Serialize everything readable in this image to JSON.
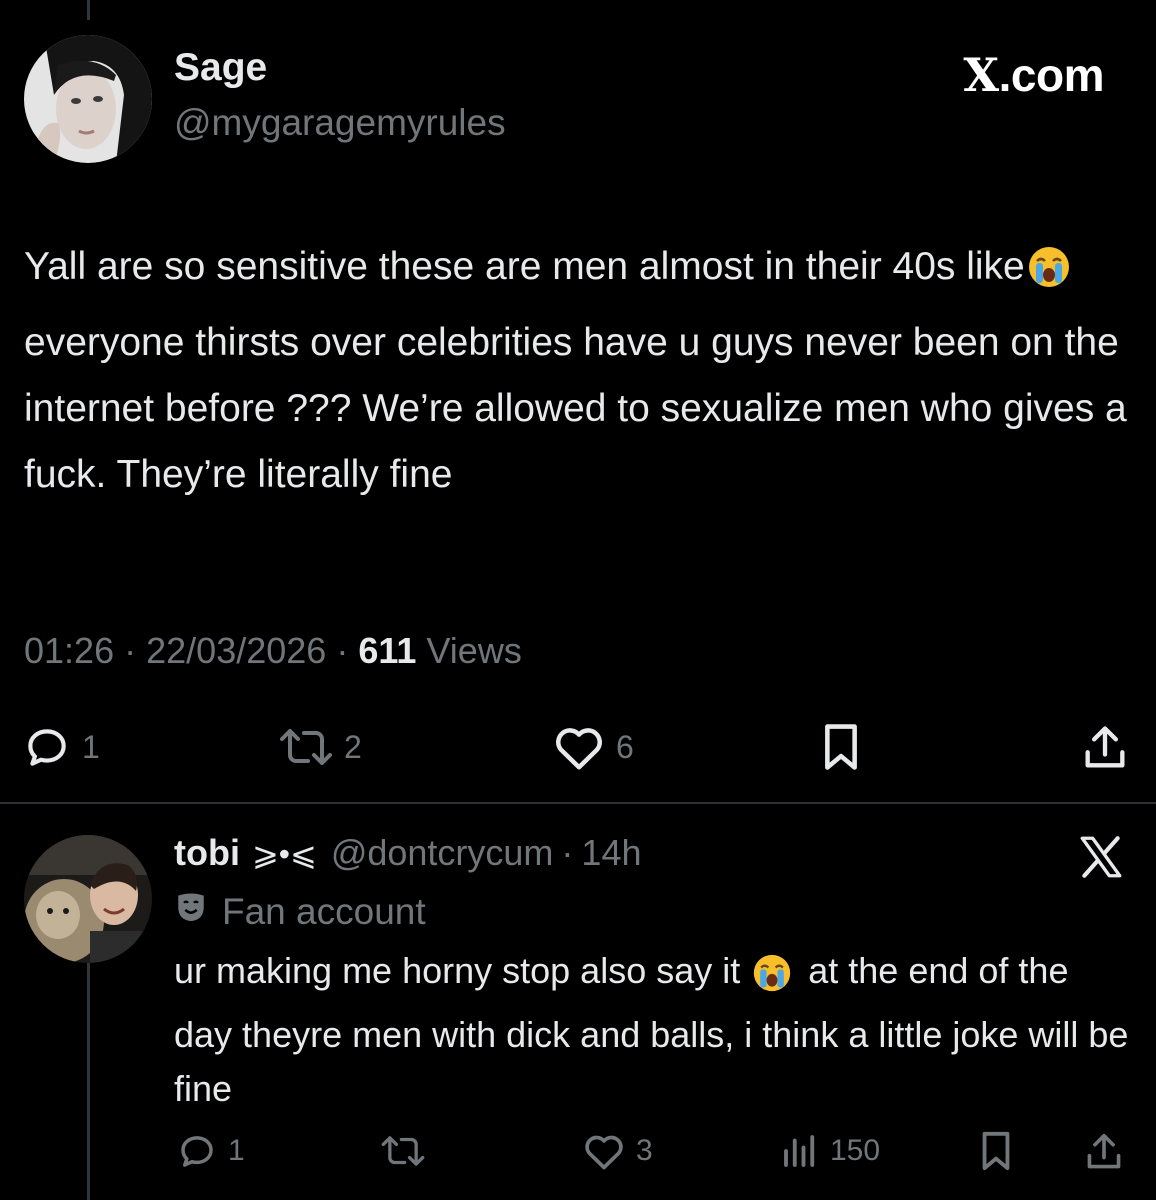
{
  "main_post": {
    "display_name": "Sage",
    "handle": "@mygaragemyrules",
    "brand": ".com",
    "brand_x": "X",
    "text_before_emoji": "Yall are so sensitive these are men almost in their 40s like",
    "emoji": "loudly-crying-face",
    "text_after_emoji": " everyone thirsts over celebrities have u guys never been on the internet before ??? We’re allowed to sexualize men who gives a fuck. They’re literally fine",
    "time": "01:26",
    "date": "22/03/2026",
    "separator": "·",
    "views_count": "611",
    "views_label": "Views",
    "actions": {
      "reply_count": "1",
      "repost_count": "2",
      "like_count": "6"
    }
  },
  "reply": {
    "display_name": "tobi",
    "name_symbol": "⩾•⩽",
    "handle": "@dontcrycum",
    "separator": "·",
    "time": "14h",
    "label": "Fan account",
    "text_before_emoji": "ur making me horny stop also say it ",
    "emoji": "loudly-crying-face",
    "text_after_emoji": "  at the end of the day theyre men with dick and balls, i think a little joke will be fine",
    "actions": {
      "reply_count": "1",
      "like_count": "3",
      "views_count": "150"
    }
  },
  "icons": {
    "reply": "speech-bubble-icon",
    "repost": "repost-arrows-icon",
    "like": "heart-icon",
    "bookmark": "bookmark-icon",
    "share": "share-upload-icon",
    "views": "bar-chart-icon",
    "brand": "x-logo-icon",
    "label": "theater-mask-icon"
  },
  "colors": {
    "background": "#000000",
    "text_primary": "#e7e9ea",
    "text_secondary": "#71767b",
    "divider": "#2f3336"
  }
}
